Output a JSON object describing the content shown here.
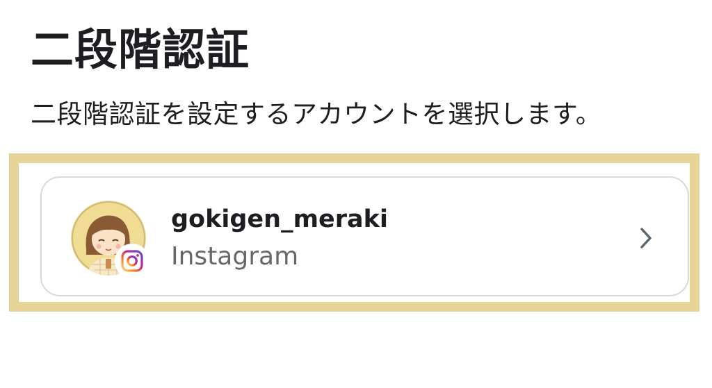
{
  "header": {
    "title": "二段階認証",
    "subtitle": "二段階認証を設定するアカウントを選択します。"
  },
  "account": {
    "username": "gokigen_meraki",
    "platform": "Instagram",
    "platform_icon": "instagram-icon",
    "avatar_icon": "user-avatar-illustration"
  },
  "colors": {
    "highlight_border": "#e6d596",
    "card_border": "#d5dae0",
    "text_primary": "#1c1e21",
    "text_secondary": "#65676b",
    "chevron": "#5b6470"
  }
}
